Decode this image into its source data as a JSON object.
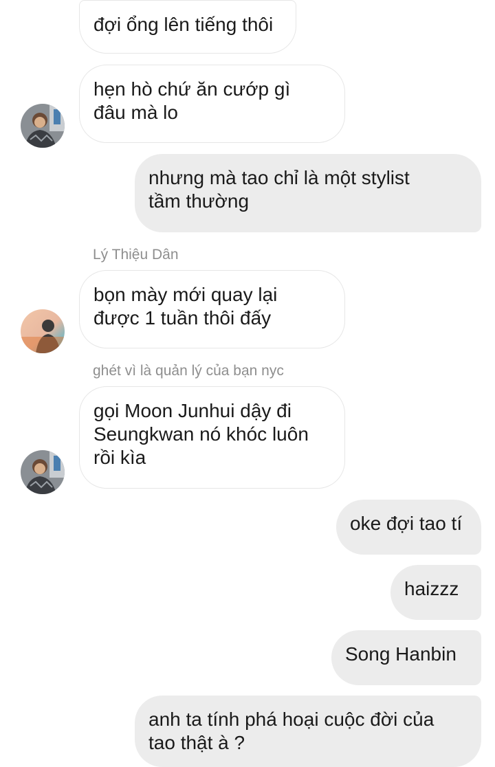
{
  "messages": [
    {
      "text": "đợi ổng lên tiếng thôi"
    },
    {
      "text": "hẹn hò chứ ăn cướp gì\nđâu mà lo"
    },
    {
      "text": "nhưng mà tao chỉ là một stylist\ntầm thường"
    },
    {
      "sender": "Lý Thiệu Dân",
      "text": "bọn mày mới quay lại\nđược 1 tuần thôi đấy"
    },
    {
      "sender": "ghét vì là quản lý của bạn nyc",
      "text": "gọi Moon Junhui dậy đi\nSeungkwan nó khóc luôn\nrồi kìa"
    },
    {
      "text": "oke đợi tao tí"
    },
    {
      "text": "haizzz"
    },
    {
      "text": "Song Hanbin"
    },
    {
      "text": "anh ta tính phá hoại cuộc đời của\ntao thật à ?"
    }
  ],
  "colors": {
    "incoming_bubble": "#ffffff",
    "incoming_border": "#e6e6e6",
    "outgoing_bubble": "#ececec",
    "sender_label": "#8e8e8e",
    "text": "#1a1a1a"
  }
}
